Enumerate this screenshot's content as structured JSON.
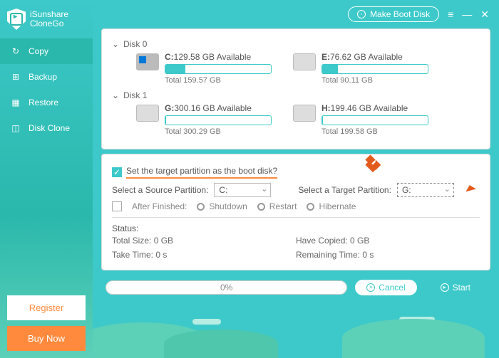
{
  "brand": {
    "line1": "iSunshare",
    "line2": "CloneGo"
  },
  "nav": {
    "copy": "Copy",
    "backup": "Backup",
    "restore": "Restore",
    "diskclone": "Disk Clone"
  },
  "buttons": {
    "register": "Register",
    "buy": "Buy Now",
    "makeboot": "Make Boot Disk"
  },
  "disks": {
    "d0": {
      "name": "Disk 0",
      "p0": {
        "letter": "C:",
        "avail": "129.58 GB Available",
        "total": "Total 159.57 GB",
        "fill": 19
      },
      "p1": {
        "letter": "E:",
        "avail": "76.62 GB Available",
        "total": "Total 90.11 GB",
        "fill": 15
      }
    },
    "d1": {
      "name": "Disk 1",
      "p0": {
        "letter": "G:",
        "avail": "300.16 GB Available",
        "total": "Total 300.29 GB",
        "fill": 0.5
      },
      "p1": {
        "letter": "H:",
        "avail": "199.46 GB Available",
        "total": "Total 199.58 GB",
        "fill": 0.5
      }
    }
  },
  "config": {
    "set_boot": "Set the target partition as the boot disk?",
    "source_lbl": "Select a Source Partition:",
    "target_lbl": "Select a Target Partition:",
    "source_val": "C:",
    "target_val": "G:",
    "after_lbl": "After Finished:",
    "shutdown": "Shutdown",
    "restart": "Restart",
    "hibernate": "Hibernate",
    "status": "Status:",
    "total_size": "Total Size: 0 GB",
    "take_time": "Take Time: 0 s",
    "copied": "Have Copied: 0 GB",
    "remaining": "Remaining Time: 0 s"
  },
  "action": {
    "progress": "0%",
    "cancel": "Cancel",
    "start": "Start"
  }
}
